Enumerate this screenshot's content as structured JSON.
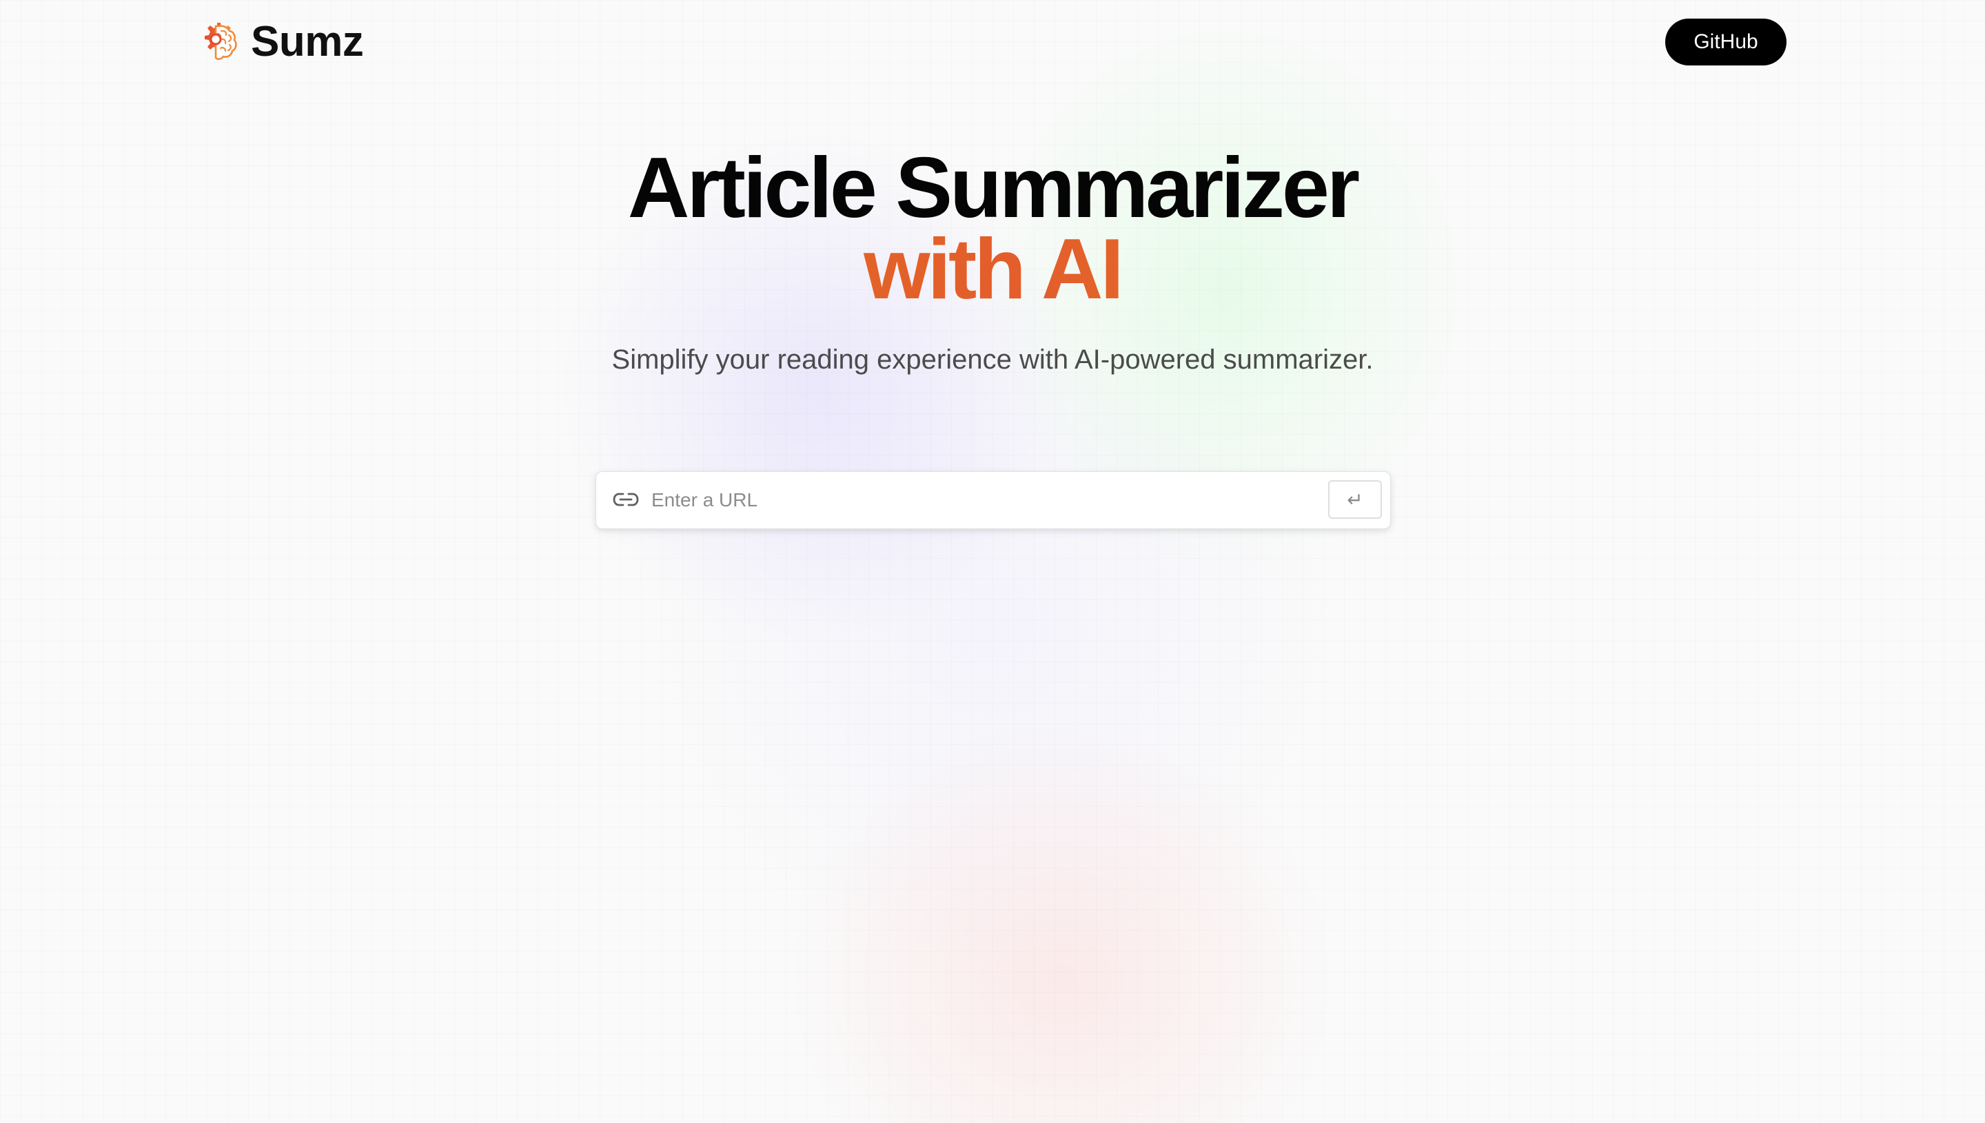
{
  "brand": {
    "name": "Sumz",
    "icon": "brain-gear-icon"
  },
  "nav": {
    "github_label": "GitHub"
  },
  "hero": {
    "title": "Article Summarizer",
    "title_accent": "with AI",
    "subtitle": "Simplify your reading experience with AI-powered summarizer."
  },
  "search": {
    "placeholder": "Enter a URL",
    "value": "",
    "icon": "link-icon",
    "submit_symbol": "↵",
    "submit_icon": "return-icon"
  },
  "colors": {
    "accent_start": "#e47c19",
    "accent_mid": "#e35d2b",
    "accent_end": "#e8a626",
    "button_background": "#000000"
  }
}
